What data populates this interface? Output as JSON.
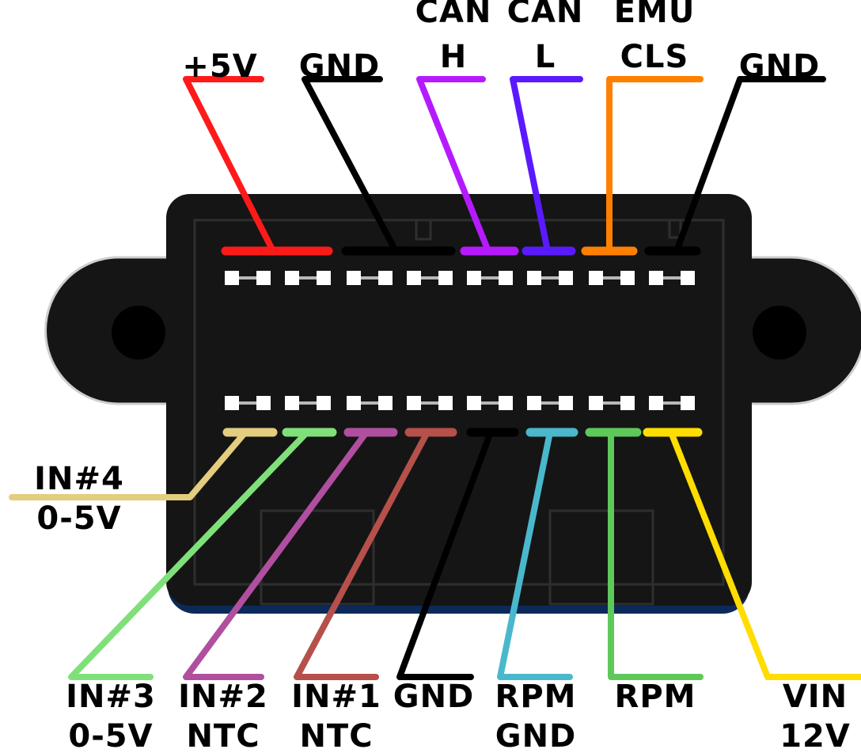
{
  "colors": {
    "background": "#ffffff",
    "housing": "#151515",
    "housing_inner": "#1e1e1e",
    "housing_base": "#0b2a5a",
    "contact": "#ffffff",
    "contact_link": "#b8b8b8"
  },
  "top_row_pins": [
    {
      "id": "plus5v",
      "label_lines": [
        "+5V"
      ],
      "color": "#ff1a1a"
    },
    {
      "id": "gnd-1",
      "label_lines": [
        "GND"
      ],
      "color": "#000000"
    },
    {
      "id": "can-h",
      "label_lines": [
        "CAN",
        "H"
      ],
      "color": "#b51aff"
    },
    {
      "id": "can-l",
      "label_lines": [
        "CAN",
        "L"
      ],
      "color": "#5a1aff"
    },
    {
      "id": "emu-cls",
      "label_lines": [
        "EMU",
        "CLS"
      ],
      "color": "#ff8000"
    },
    {
      "id": "gnd-2",
      "label_lines": [
        "GND"
      ],
      "color": "#000000"
    }
  ],
  "bottom_row_pins": [
    {
      "id": "in4",
      "label_lines": [
        "IN#4",
        "0-5V"
      ],
      "color": "#e3cd7e"
    },
    {
      "id": "in3",
      "label_lines": [
        "IN#3",
        "0-5V"
      ],
      "color": "#7fe07a"
    },
    {
      "id": "in2",
      "label_lines": [
        "IN#2",
        "NTC"
      ],
      "color": "#b04fa0"
    },
    {
      "id": "in1",
      "label_lines": [
        "IN#1",
        "NTC"
      ],
      "color": "#b5504a"
    },
    {
      "id": "gnd-3",
      "label_lines": [
        "GND"
      ],
      "color": "#000000"
    },
    {
      "id": "rpm-gnd",
      "label_lines": [
        "RPM",
        "GND"
      ],
      "color": "#4ab8cc"
    },
    {
      "id": "rpm",
      "label_lines": [
        "RPM"
      ],
      "color": "#5ec85a"
    },
    {
      "id": "vin",
      "label_lines": [
        "VIN",
        "12V"
      ],
      "color": "#ffdd00"
    }
  ]
}
